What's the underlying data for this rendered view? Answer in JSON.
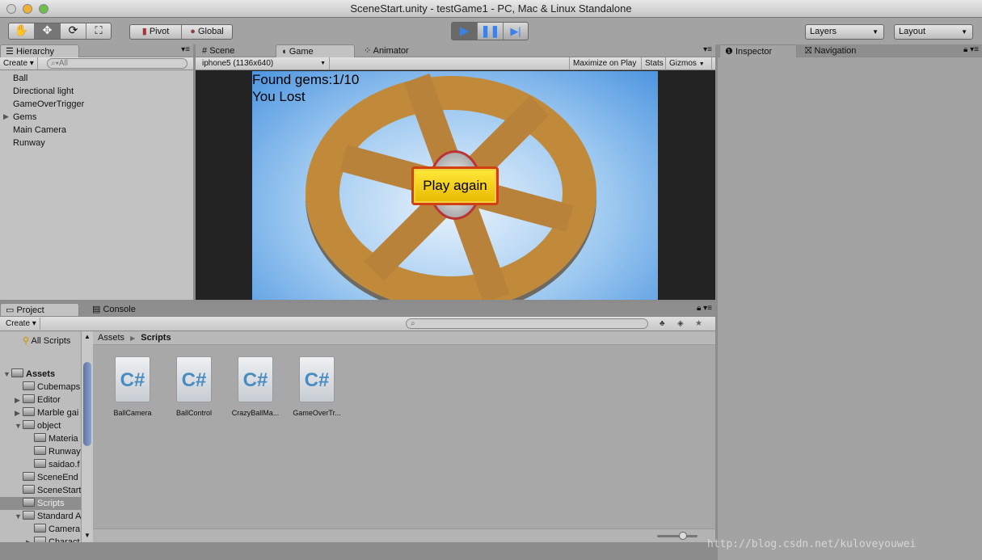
{
  "window": {
    "title": "SceneStart.unity - testGame1 - PC, Mac & Linux Standalone"
  },
  "toolbar": {
    "pivot": "Pivot",
    "global": "Global",
    "layers": "Layers",
    "layout": "Layout",
    "accent": "#3a82e8"
  },
  "hierarchy": {
    "tab": "Hierarchy",
    "create": "Create",
    "search_placeholder": "All",
    "items": [
      "Ball",
      "Directional light",
      "GameOverTrigger",
      "Gems",
      "Main Camera",
      "Runway"
    ]
  },
  "game": {
    "tabs": [
      "Scene",
      "Game",
      "Animator"
    ],
    "resolution": "iphone5 (1136x640)",
    "maximize": "Maximize on Play",
    "stats": "Stats",
    "gizmos": "Gizmos",
    "found_gems": "Found gems:1/10",
    "status": "You Lost",
    "play_again": "Play again"
  },
  "inspector": {
    "tabs": [
      "Inspector",
      "Navigation"
    ]
  },
  "project": {
    "tabs": [
      "Project",
      "Console"
    ],
    "create": "Create",
    "favorites": [
      "All Scripts"
    ],
    "tree": [
      {
        "label": "Assets",
        "depth": 0,
        "arrow": "▼",
        "bold": true
      },
      {
        "label": "Cubemaps",
        "depth": 1,
        "arrow": ""
      },
      {
        "label": "Editor",
        "depth": 1,
        "arrow": "▶"
      },
      {
        "label": "Marble gai",
        "depth": 1,
        "arrow": "▶"
      },
      {
        "label": "object",
        "depth": 1,
        "arrow": "▼"
      },
      {
        "label": "Materia",
        "depth": 2,
        "arrow": ""
      },
      {
        "label": "Runway",
        "depth": 2,
        "arrow": ""
      },
      {
        "label": "saidao.f",
        "depth": 2,
        "arrow": ""
      },
      {
        "label": "SceneEnd",
        "depth": 1,
        "arrow": ""
      },
      {
        "label": "SceneStart",
        "depth": 1,
        "arrow": ""
      },
      {
        "label": "Scripts",
        "depth": 1,
        "arrow": "",
        "selected": true
      },
      {
        "label": "Standard A",
        "depth": 1,
        "arrow": "▼"
      },
      {
        "label": "Camera",
        "depth": 2,
        "arrow": ""
      },
      {
        "label": "Charact",
        "depth": 2,
        "arrow": "▶"
      }
    ],
    "breadcrumb": [
      "Assets",
      "Scripts"
    ],
    "files": [
      "BallCamera",
      "BallControl",
      "CrazyBallMa...",
      "GameOverTr..."
    ],
    "file_icon": "C#"
  },
  "watermark": "http://blog.csdn.net/kuloveyouwei"
}
